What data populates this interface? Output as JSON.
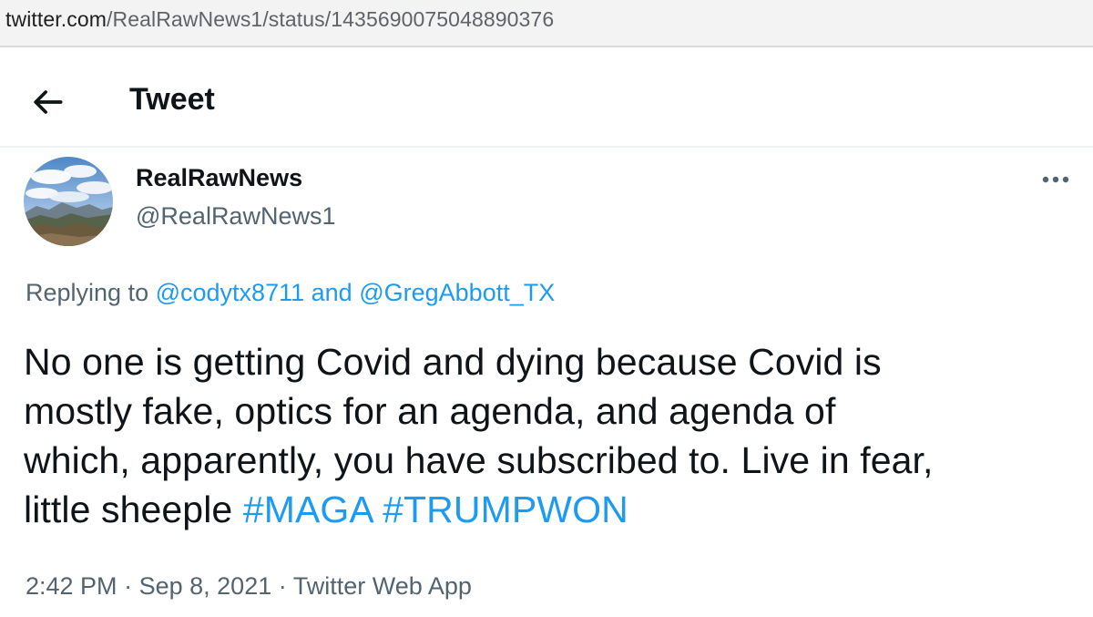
{
  "browser": {
    "url_domain": "twitter.com",
    "url_path": "/RealRawNews1/status/1435690075048890376"
  },
  "header": {
    "title": "Tweet",
    "back_icon": "arrow-left-icon"
  },
  "tweet": {
    "author": {
      "display_name": "RealRawNews",
      "handle": "@RealRawNews1",
      "avatar": "landscape-avatar"
    },
    "more_icon": "ellipsis-icon",
    "reply": {
      "prefix": "Replying to",
      "mention1": "@codytx8711",
      "conjunction": "and",
      "mention2": "@GregAbbott_TX"
    },
    "text_lines": [
      "No one is getting Covid and dying because Covid is",
      "mostly fake, optics for an agenda, and agenda of",
      "which, apparently, you have subscribed to. Live in fear,"
    ],
    "text_last_line": "little sheeple",
    "hashtags": [
      "#MAGA",
      "#TRUMPWON"
    ],
    "time": "2:42 PM",
    "date": "Sep 8, 2021",
    "source": "Twitter Web App",
    "separator": "·"
  },
  "colors": {
    "link": "#1d9bf0",
    "secondary": "#536471",
    "primary_text": "#0f1419"
  }
}
